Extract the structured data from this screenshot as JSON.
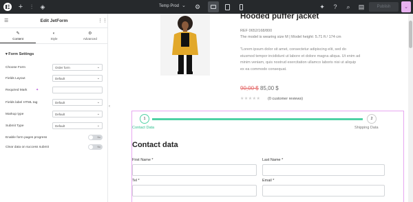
{
  "topbar": {
    "site_name": "Temp Prod",
    "publish_label": "Publish"
  },
  "panel": {
    "title": "Edit JetForm",
    "tabs": [
      {
        "label": "Content",
        "icon": "pencil-icon"
      },
      {
        "label": "Style",
        "icon": "contrast-icon"
      },
      {
        "label": "Advanced",
        "icon": "gear-icon"
      }
    ],
    "section": "Form Settings",
    "fields": [
      {
        "label": "Choose Form",
        "value": "Order form",
        "kind": "select"
      },
      {
        "label": "Fields Layout",
        "value": "Default",
        "kind": "select"
      },
      {
        "label": "Required Mark",
        "value": "",
        "kind": "input"
      },
      {
        "label": "Fields label HTML tag",
        "value": "Default",
        "kind": "select"
      },
      {
        "label": "Markup type",
        "value": "Default",
        "kind": "select"
      },
      {
        "label": "Submit Type",
        "value": "Default",
        "kind": "select"
      },
      {
        "label": "Enable form pages progress",
        "value": "No",
        "kind": "toggle"
      },
      {
        "label": "Clear data on success submit",
        "value": "No",
        "kind": "toggle"
      }
    ]
  },
  "product": {
    "title": "Hooded puffer jacket",
    "ref": "REF 0652/168/800",
    "model": "The model is wearing size M | Model height: 5.71 ft / 174 cm",
    "description": "\"Lorem ipsum dolor sit amet, consectetur adipiscing elit, sed do eiusmod tempor incididunt ut labore et dolore magna aliqua. Ut enim ad minim veniam, quis nostrud exercitation ullamco laboris nisi ut aliquip ex ea commodo consequat.",
    "price_old": "90,00 $",
    "price_new": "85,00 $",
    "stars": "★★★★★",
    "reviews": "(0 customer reviews)"
  },
  "form": {
    "steps": [
      {
        "number": "1",
        "label": "Contact Data"
      },
      {
        "number": "2",
        "label": "Shipping Data"
      }
    ],
    "title": "Contact data",
    "fields": {
      "first_name": "First Name *",
      "last_name": "Last Name *",
      "tel": "Tel *",
      "email": "Email *"
    }
  }
}
